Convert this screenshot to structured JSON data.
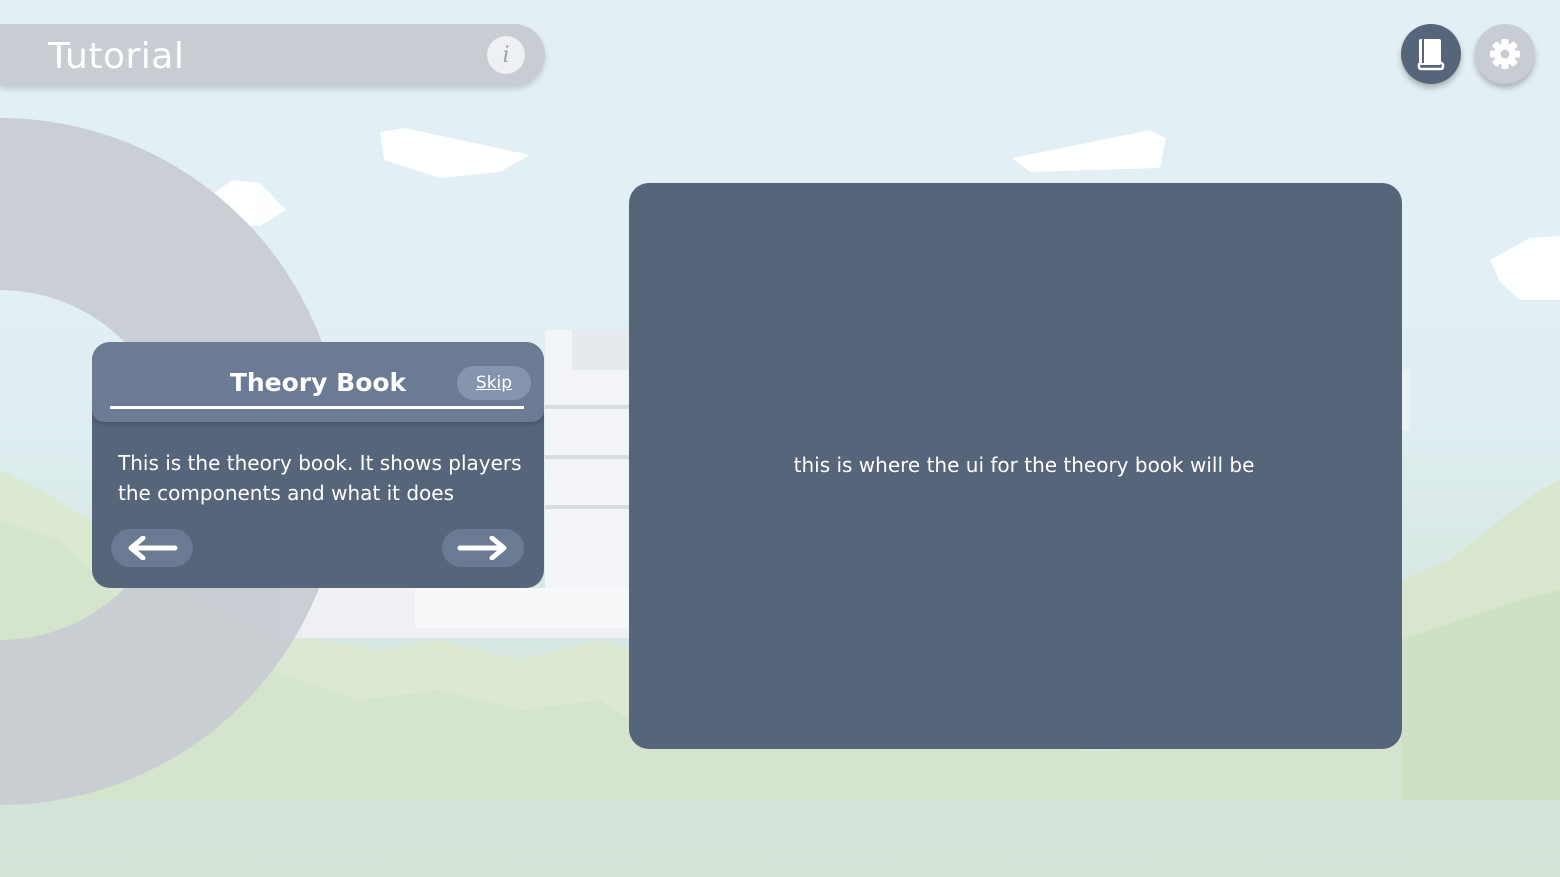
{
  "header": {
    "title": "Tutorial",
    "info_glyph": "i"
  },
  "toolbar": {
    "book_icon": "book-icon",
    "gear_icon": "gear-icon"
  },
  "tutorial": {
    "title": "Theory Book",
    "skip_label": "Skip",
    "body": "This is the theory book. It shows players the components and what it does",
    "prev_icon": "arrow-left-icon",
    "next_icon": "arrow-right-icon"
  },
  "panel": {
    "placeholder_text": "this is where the ui for the theory book will be"
  },
  "colors": {
    "panel": "#56657a",
    "panel_header": "#6b7b93",
    "skip": "#8595ad",
    "title_bar": "#c8ccd3",
    "sky": "#e3eff4"
  }
}
